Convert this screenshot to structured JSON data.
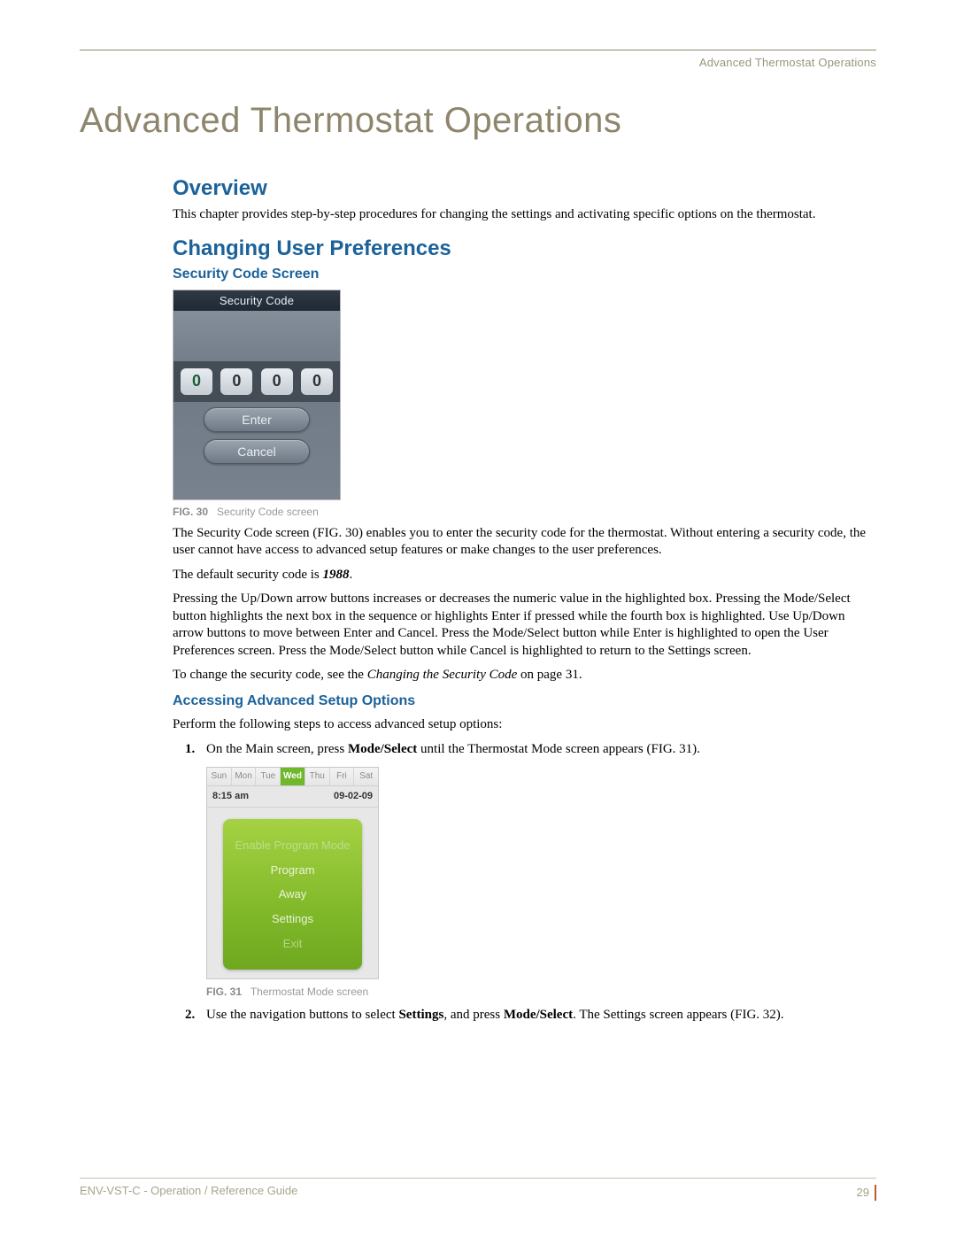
{
  "running_head": "Advanced Thermostat Operations",
  "chapter_title": "Advanced Thermostat Operations",
  "h_overview": "Overview",
  "overview_para": "This chapter provides step-by-step procedures for changing the settings and activating specific options on the thermostat.",
  "h_changing": "Changing User Preferences",
  "h_security": "Security Code Screen",
  "sec_fig": {
    "header": "Security Code",
    "digits": [
      "0",
      "0",
      "0",
      "0"
    ],
    "enter": "Enter",
    "cancel": "Cancel"
  },
  "fig30_label": "FIG. 30",
  "fig30_text": "Security Code screen",
  "sec_p1": "The Security Code screen (FIG. 30) enables you to enter the security code for the thermostat. Without entering a security code, the user cannot have access to advanced setup features or make changes to the user preferences.",
  "sec_p2a": "The default security code is ",
  "sec_p2b": "1988",
  "sec_p2c": ".",
  "sec_p3": "Pressing the Up/Down arrow buttons increases or decreases the numeric value in the highlighted box. Pressing the Mode/Select button highlights the next box in the sequence or highlights Enter if pressed while the fourth box is highlighted. Use Up/Down arrow buttons to move between Enter and Cancel. Press the Mode/Select button while Enter is highlighted to open the User Preferences screen. Press the Mode/Select button while Cancel is highlighted to return to the Settings screen.",
  "sec_p4a": "To change the security code, see the ",
  "sec_p4b": "Changing the Security Code",
  "sec_p4c": "  on page 31.",
  "h_access": "Accessing Advanced Setup Options",
  "access_intro": "Perform the following steps to access advanced setup options:",
  "step1a": "On the Main screen, press ",
  "step1b": "Mode/Select",
  "step1c": " until the Thermostat Mode screen appears (FIG. 31).",
  "mode_fig": {
    "days": [
      "Sun",
      "Mon",
      "Tue",
      "Wed",
      "Thu",
      "Fri",
      "Sat"
    ],
    "current_day_index": 3,
    "time": "8:15 am",
    "date": "09-02-09",
    "items": [
      "Enable Program Mode",
      "Program",
      "Away",
      "Settings",
      "Exit"
    ]
  },
  "fig31_label": "FIG. 31",
  "fig31_text": "Thermostat Mode screen",
  "step2a": "Use the navigation buttons to select ",
  "step2b": "Settings",
  "step2c": ", and press ",
  "step2d": "Mode/Select",
  "step2e": ". The Settings screen appears (FIG. 32).",
  "footer_left": "ENV-VST-C - Operation / Reference Guide",
  "footer_page": "29"
}
